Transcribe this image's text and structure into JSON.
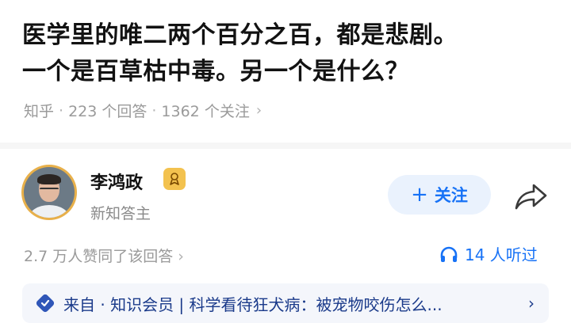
{
  "question": {
    "title_line1": "医学里的唯二两个百分之百，都是悲剧。",
    "title_line2": "一个是百草枯中毒。另一个是什么？"
  },
  "meta": {
    "platform": "知乎",
    "sep": "·",
    "answers": "223 个回答",
    "followers": "1362 个关注",
    "chevron": "›"
  },
  "author": {
    "name": "李鸿政",
    "title": "新知答主",
    "badge_icon": "zhihu-new-knowledge-badge-icon"
  },
  "actions": {
    "follow_plus": "+",
    "follow_label": "关注",
    "share_icon": "share-arrow-icon"
  },
  "stats": {
    "likes": "2.7 万人赞同了该回答",
    "likes_chevron": "›",
    "listened": "14 人听过",
    "listened_icon": "headphones-icon"
  },
  "source": {
    "icon": "zhihu-member-icon",
    "text": "来自 · 知识会员 | 科学看待狂犬病：被宠物咬伤怎么...",
    "chevron": "›"
  },
  "colors": {
    "accent": "#1772f6",
    "badge": "#f3c24f",
    "avatar_ring": "#e8b04a",
    "source_bg": "#f4f6fb"
  }
}
